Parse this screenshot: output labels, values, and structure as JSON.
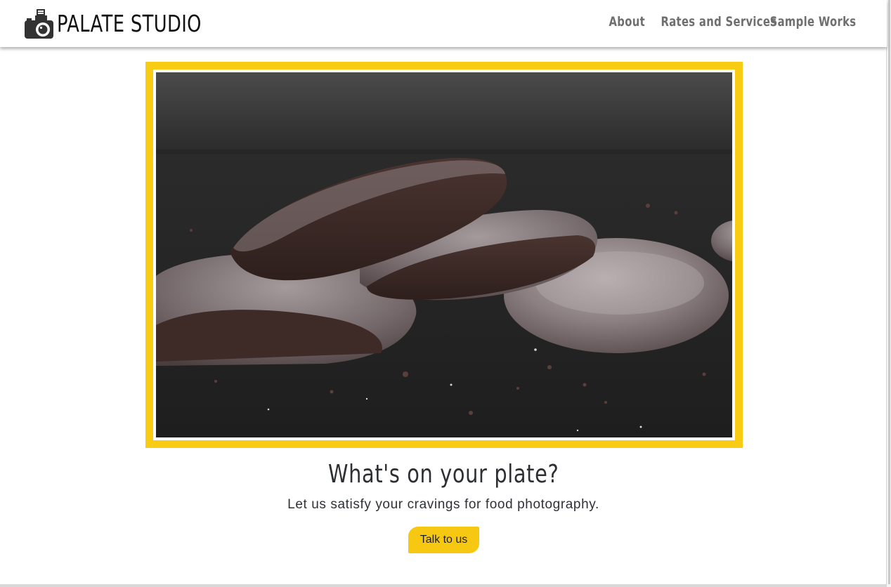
{
  "header": {
    "brand_name": "PALATE STUDIO",
    "brand_icon": "camera-icon",
    "nav": [
      {
        "label": "About"
      },
      {
        "label": "Rates and Services"
      },
      {
        "label": "Sample Works"
      }
    ]
  },
  "hero": {
    "image_subject": "stacked chocolate crinkle cookies on dark slate",
    "frame_color": "#f7cc12"
  },
  "main": {
    "headline": "What's on your plate?",
    "tagline": "Let us satisfy your cravings for food photography.",
    "cta_label": "Talk to us"
  },
  "colors": {
    "accent": "#f7cc12",
    "text": "#2d2f33",
    "nav_text": "#6f6f6f"
  }
}
